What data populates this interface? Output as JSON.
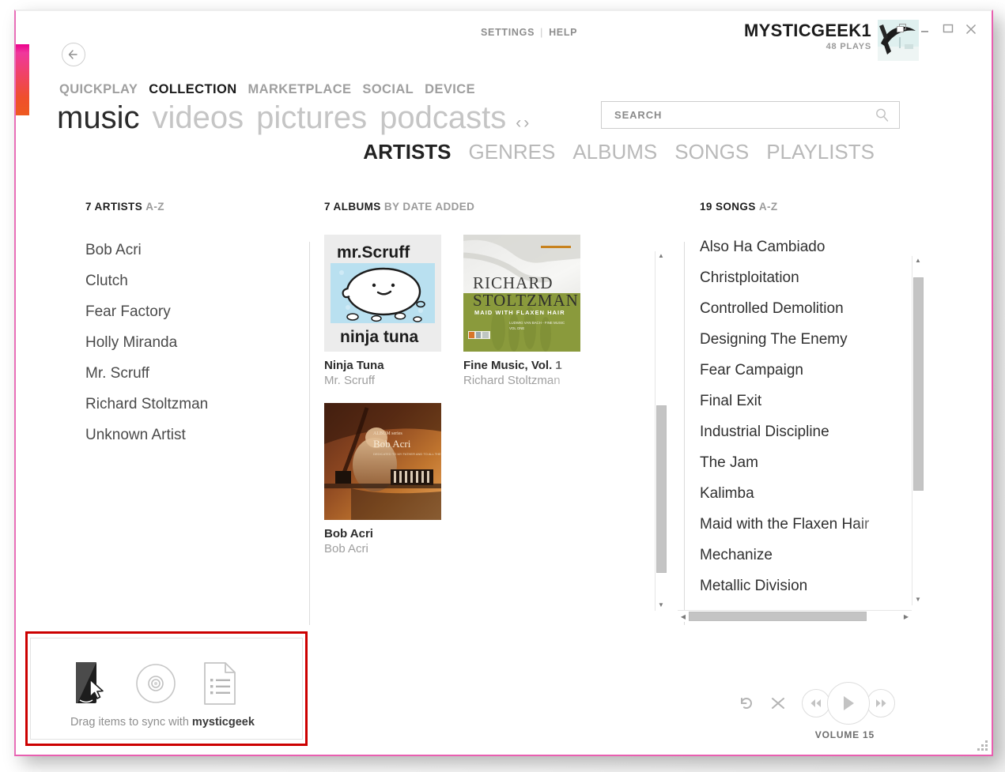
{
  "titlebar": {
    "settings_label": "SETTINGS",
    "separator": "|",
    "help_label": "HELP",
    "username": "MYSTICGEEK1",
    "plays": "48 PLAYS",
    "window_controls": [
      "restore-cascade",
      "minimize",
      "maximize",
      "close"
    ]
  },
  "nav": {
    "back_icon": "back-arrow-icon",
    "top_items": [
      {
        "label": "QUICKPLAY",
        "active": false
      },
      {
        "label": "COLLECTION",
        "active": true
      },
      {
        "label": "MARKETPLACE",
        "active": false
      },
      {
        "label": "SOCIAL",
        "active": false
      },
      {
        "label": "DEVICE",
        "active": false
      }
    ],
    "sub_items": [
      {
        "label": "music",
        "active": true
      },
      {
        "label": "videos",
        "active": false
      },
      {
        "label": "pictures",
        "active": false
      },
      {
        "label": "podcasts",
        "active": false
      }
    ],
    "prev_arrow": "‹",
    "next_arrow": "›"
  },
  "search": {
    "placeholder": "SEARCH",
    "value": "",
    "icon": "search-icon"
  },
  "pivot": {
    "items": [
      {
        "label": "ARTISTS",
        "active": true
      },
      {
        "label": "GENRES",
        "active": false
      },
      {
        "label": "ALBUMS",
        "active": false
      },
      {
        "label": "SONGS",
        "active": false
      },
      {
        "label": "PLAYLISTS",
        "active": false
      }
    ]
  },
  "artists_column": {
    "count_label": "7 ARTISTS",
    "sort_label": "A-Z",
    "items": [
      "Bob Acri",
      "Clutch",
      "Fear Factory",
      "Holly Miranda",
      "Mr. Scruff",
      "Richard Stoltzman",
      "Unknown Artist"
    ]
  },
  "albums_column": {
    "count_label": "7 ALBUMS",
    "sort_label": "BY DATE ADDED",
    "items": [
      {
        "title": "Ninja Tuna",
        "artist": "Mr. Scruff",
        "art": "mr-scruff-ninja-tuna-cover",
        "truncated": false
      },
      {
        "title": "Fine Music, Vol. 1",
        "artist": "Richard Stoltzman",
        "art": "richard-stoltzman-cover",
        "truncated": true
      },
      {
        "title": "Bob Acri",
        "artist": "Bob Acri",
        "art": "bob-acri-piano-cover",
        "truncated": false
      }
    ],
    "scroll": {
      "up_arrow": "▲",
      "down_arrow": "▼"
    }
  },
  "songs_column": {
    "count_label": "19 SONGS",
    "sort_label": "A-Z",
    "items": [
      {
        "title": "Also Ha Cambiado",
        "truncated": false
      },
      {
        "title": "Christploitation",
        "truncated": false
      },
      {
        "title": "Controlled Demolition",
        "truncated": false
      },
      {
        "title": "Designing The Enemy",
        "truncated": false
      },
      {
        "title": "Fear Campaign",
        "truncated": false
      },
      {
        "title": "Final Exit",
        "truncated": false
      },
      {
        "title": "Industrial Discipline",
        "truncated": false
      },
      {
        "title": "The Jam",
        "truncated": false
      },
      {
        "title": "Kalimba",
        "truncated": false
      },
      {
        "title": "Maid with the Flaxen Hair",
        "truncated": true
      },
      {
        "title": "Mechanize",
        "truncated": false
      },
      {
        "title": "Metallic Division",
        "truncated": false
      }
    ],
    "scroll": {
      "up_arrow": "▲",
      "down_arrow": "▼",
      "left_arrow": "◀",
      "right_arrow": "▶"
    }
  },
  "sync_panel": {
    "text_prefix": "Drag items to sync with ",
    "device_name": "mysticgeek",
    "icons": [
      "device-phone-icon",
      "cd-disc-icon",
      "playlist-document-icon"
    ],
    "highlight_color": "#cc0000"
  },
  "transport": {
    "repeat_icon": "repeat-icon",
    "shuffle_icon": "shuffle-icon",
    "previous_icon": "previous-track-icon",
    "play_icon": "play-icon",
    "next_icon": "next-track-icon",
    "volume_label": "VOLUME 15"
  },
  "theme": {
    "accent_start": "#ec008c",
    "accent_end": "#ee5a20",
    "window_border": "#e85fb0",
    "highlight": "#cc0000"
  }
}
